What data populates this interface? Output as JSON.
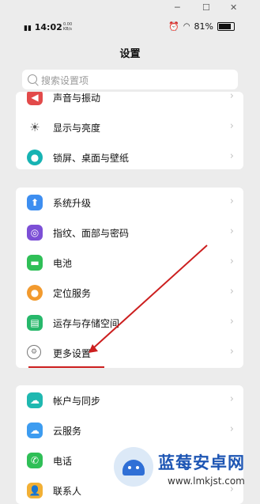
{
  "window_controls": {
    "minimize": "─",
    "maximize": "☐",
    "close": "✕"
  },
  "status_bar": {
    "time": "14:02",
    "speed_value": "0.00",
    "speed_unit": "KB/s",
    "battery": "81%",
    "battery_level": 0.81
  },
  "page_title": "设置",
  "search": {
    "placeholder": "搜索设置项"
  },
  "groups": [
    {
      "items": [
        {
          "label": "声音与振动",
          "icon": "speaker-icon",
          "color": "#e24a4a"
        },
        {
          "label": "显示与亮度",
          "icon": "sun-icon",
          "color": "#5a5a5a"
        },
        {
          "label": "锁屏、桌面与壁纸",
          "icon": "palette-icon",
          "color": "#17b3b3"
        }
      ]
    },
    {
      "items": [
        {
          "label": "系统升级",
          "icon": "system-update-icon",
          "color": "#3d8ef0"
        },
        {
          "label": "指纹、面部与密码",
          "icon": "fingerprint-icon",
          "color": "#7c4fd6"
        },
        {
          "label": "电池",
          "icon": "battery-icon",
          "color": "#2fbf57"
        },
        {
          "label": "定位服务",
          "icon": "location-icon",
          "color": "#f29a2e"
        },
        {
          "label": "运存与存储空间",
          "icon": "storage-icon",
          "color": "#27b86b"
        },
        {
          "label": "更多设置",
          "icon": "more-settings-icon",
          "color": "#777777"
        }
      ]
    },
    {
      "items": [
        {
          "label": "帐户与同步",
          "icon": "account-sync-icon",
          "color": "#1fb8b0"
        },
        {
          "label": "云服务",
          "icon": "cloud-icon",
          "color": "#3d9cf0"
        },
        {
          "label": "电话",
          "icon": "phone-icon",
          "color": "#2fbf57"
        },
        {
          "label": "联系人",
          "icon": "contacts-icon",
          "color": "#f2b035"
        }
      ]
    }
  ],
  "chevron": "›",
  "watermark": {
    "brand": "蓝莓安卓网",
    "url": "www.lmkjst.com"
  },
  "annotation": {
    "arrow_color": "#cc1f1f"
  }
}
